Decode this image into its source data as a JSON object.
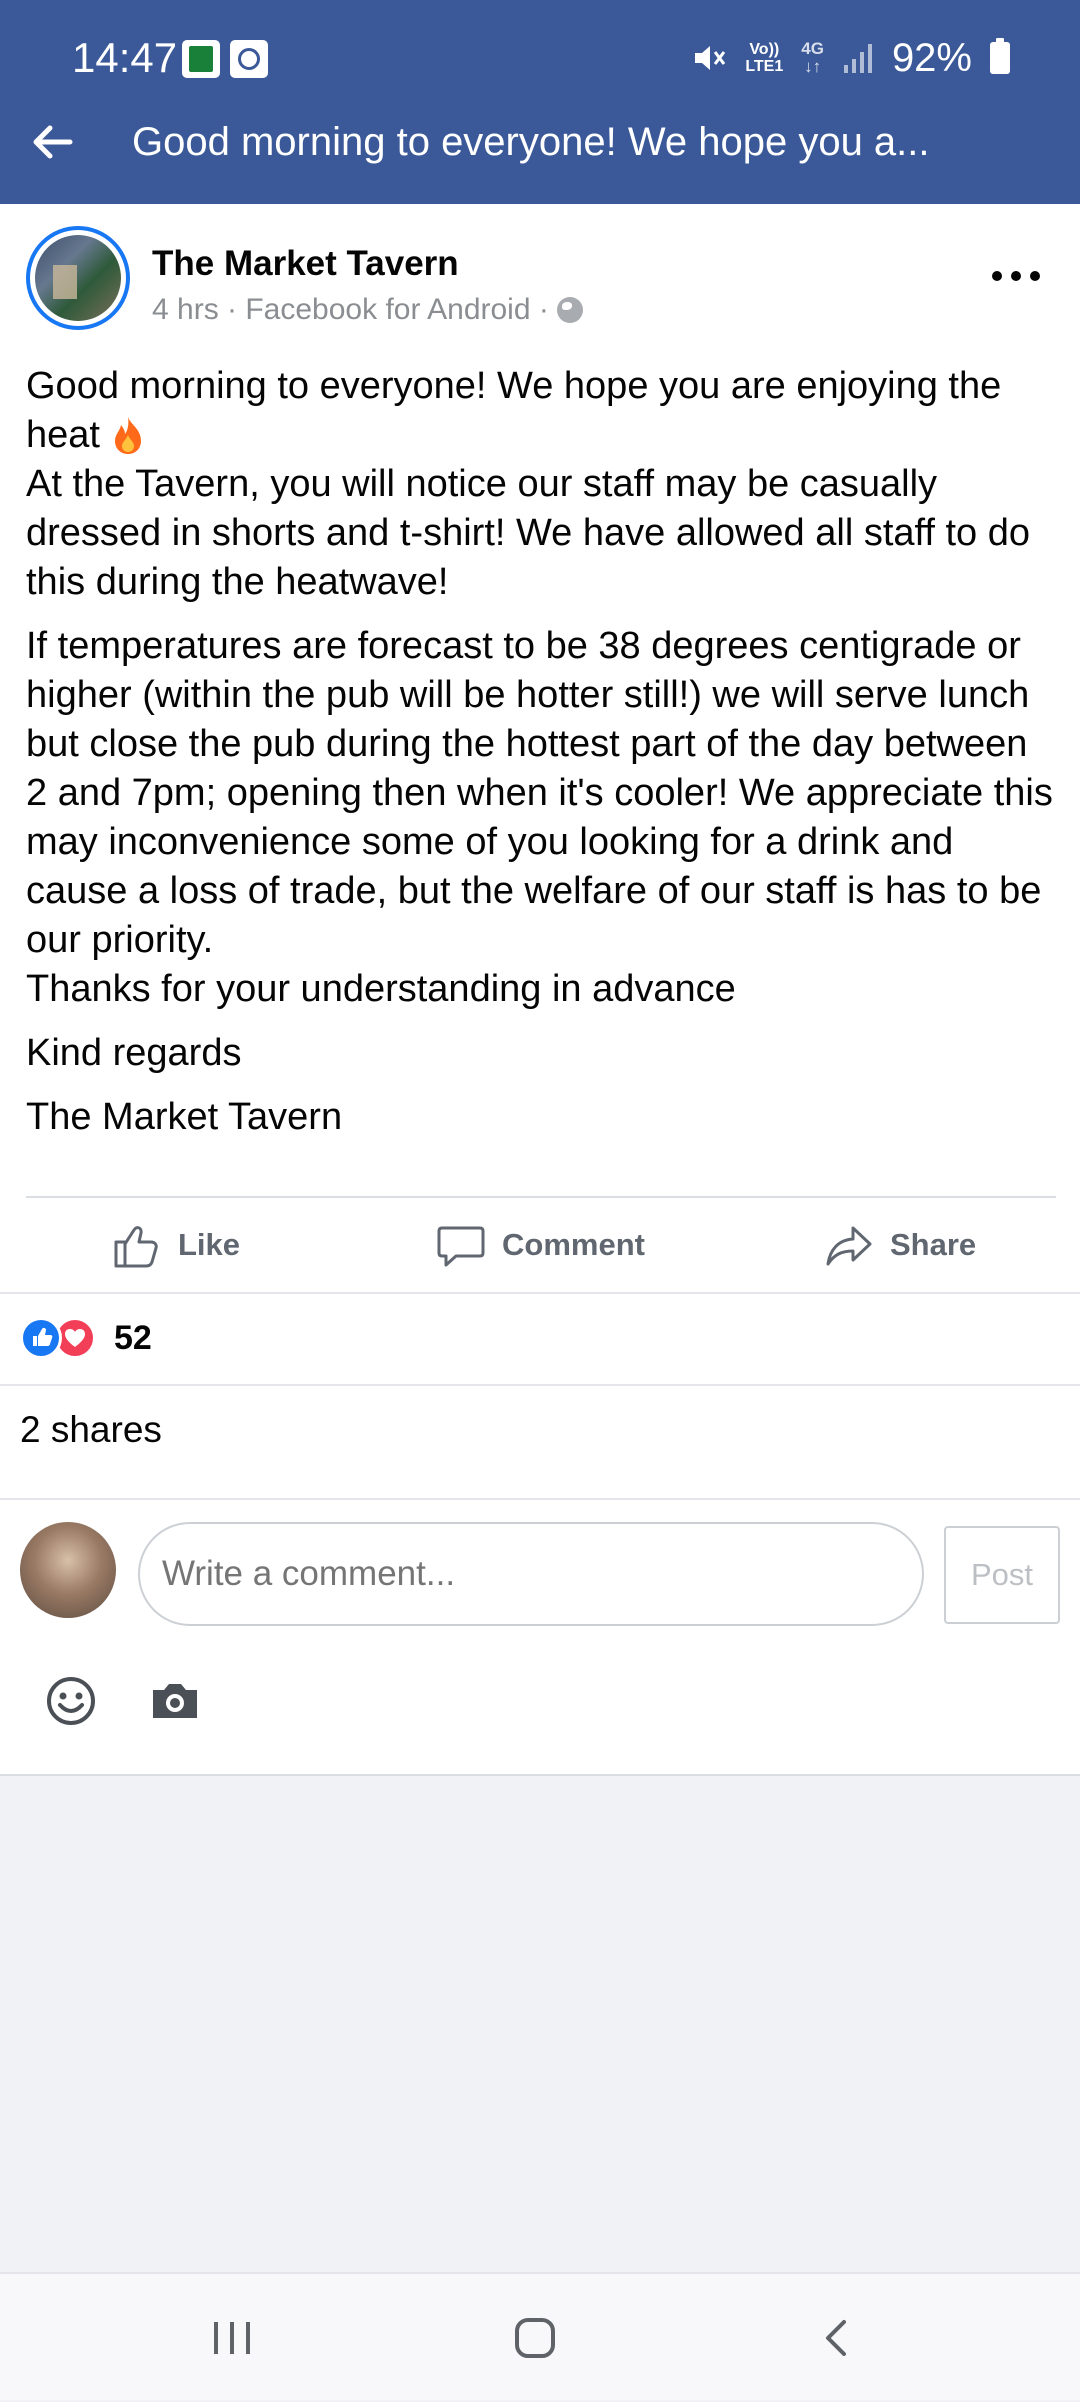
{
  "status_bar": {
    "time": "14:47",
    "volte_line1": "Vo))",
    "volte_line2": "LTE1",
    "network": "4G",
    "battery": "92%"
  },
  "app_bar": {
    "title": "Good morning to everyone! We hope you a..."
  },
  "post": {
    "author": "The Market Tavern",
    "meta": "4 hrs · Facebook for Android ·",
    "body": {
      "line1": "Good morning to everyone! We hope you are enjoying the heat",
      "line2": "At the Tavern, you will notice our staff may be casually dressed in shorts and t-shirt! We have allowed all staff to do this during the heatwave!",
      "para2": "If temperatures are forecast to be 38 degrees centigrade or higher (within the pub will be hotter still!) we will serve lunch but close the pub during the hottest part of the day between 2 and 7pm; opening then when it's cooler! We appreciate this may inconvenience some of you looking for a drink and cause a loss of trade, but the welfare of our staff is has to be our priority.",
      "thanks": "Thanks for your understanding in advance",
      "regards": "Kind regards",
      "signature": "The Market Tavern"
    }
  },
  "actions": {
    "like": "Like",
    "comment": "Comment",
    "share": "Share"
  },
  "reactions": {
    "count": "52",
    "types": [
      "like-icon",
      "love-icon"
    ]
  },
  "shares": "2 shares",
  "comment_box": {
    "placeholder": "Write a comment...",
    "post_label": "Post"
  },
  "colors": {
    "app_bar": "#3b5998",
    "like_blue": "#1877f2",
    "love_red": "#f33e58"
  }
}
